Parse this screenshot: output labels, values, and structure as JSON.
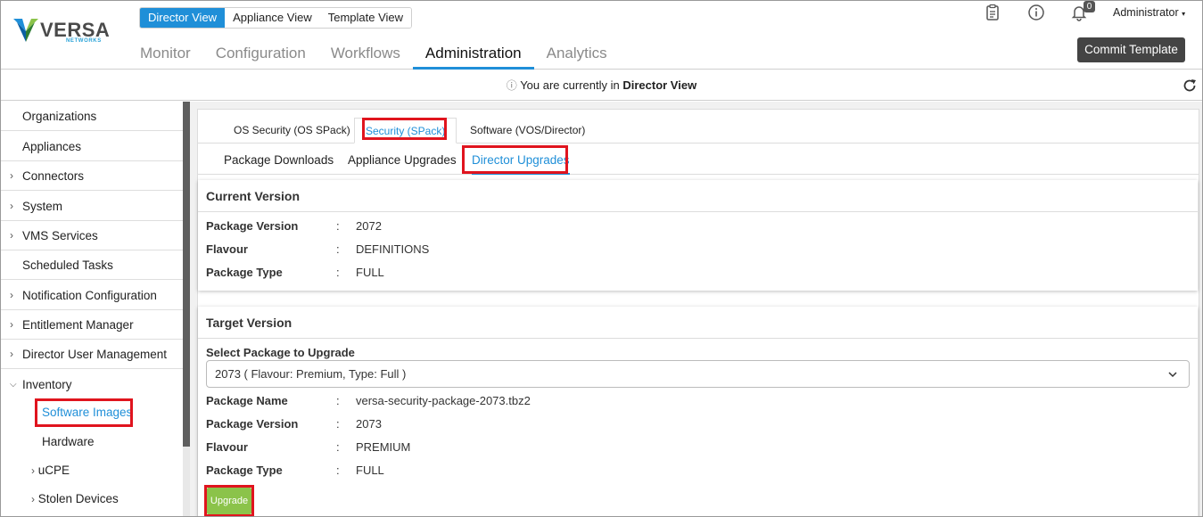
{
  "brand": {
    "name": "VERSA",
    "sub": "NETWORKS"
  },
  "view_switch": {
    "items": [
      "Director View",
      "Appliance View",
      "Template View"
    ],
    "active": "Director View"
  },
  "main_nav": {
    "items": [
      "Monitor",
      "Configuration",
      "Workflows",
      "Administration",
      "Analytics"
    ],
    "active": "Administration"
  },
  "header": {
    "notifications_count": "0",
    "user_menu": "Administrator",
    "commit_label": "Commit Template",
    "icons": [
      "clipboard-icon",
      "info-icon",
      "bell-icon"
    ]
  },
  "banner": {
    "prefix": "You are currently in",
    "view": "Director View"
  },
  "sidebar": {
    "items": [
      {
        "label": "Organizations",
        "chevron": ""
      },
      {
        "label": "Appliances",
        "chevron": ""
      },
      {
        "label": "Connectors",
        "chevron": ">"
      },
      {
        "label": "System",
        "chevron": ">"
      },
      {
        "label": "VMS Services",
        "chevron": ">"
      },
      {
        "label": "Scheduled Tasks",
        "chevron": ""
      },
      {
        "label": "Notification Configuration",
        "chevron": ">"
      },
      {
        "label": "Entitlement Manager",
        "chevron": ">"
      },
      {
        "label": "Director User Management",
        "chevron": ">"
      },
      {
        "label": "Inventory",
        "chevron": "v"
      }
    ],
    "sub_items": [
      {
        "label": "Software Images",
        "chevron": ""
      },
      {
        "label": "Hardware",
        "chevron": ""
      },
      {
        "label": "uCPE",
        "chevron": ">"
      },
      {
        "label": "Stolen Devices",
        "chevron": ">"
      }
    ],
    "active_sub": "Software Images"
  },
  "tabs_top": {
    "items": [
      "OS Security (OS SPack)",
      "Security (SPack)",
      "Software (VOS/Director)"
    ],
    "active": "Security (SPack)"
  },
  "tabs_sub": {
    "items": [
      "Package Downloads",
      "Appliance Upgrades",
      "Director Upgrades"
    ],
    "active": "Director Upgrades"
  },
  "current_version": {
    "title": "Current Version",
    "rows": [
      {
        "key": "Package Version",
        "sep": ":",
        "value": "2072"
      },
      {
        "key": "Flavour",
        "sep": ":",
        "value": "DEFINITIONS"
      },
      {
        "key": "Package Type",
        "sep": ":",
        "value": "FULL"
      }
    ]
  },
  "target_version": {
    "title": "Target Version",
    "select_label": "Select Package to Upgrade",
    "select_value": "2073 ( Flavour: Premium, Type: Full )",
    "rows": [
      {
        "key": "Package Name",
        "sep": ":",
        "value": "versa-security-package-2073.tbz2"
      },
      {
        "key": "Package Version",
        "sep": ":",
        "value": "2073"
      },
      {
        "key": "Flavour",
        "sep": ":",
        "value": "PREMIUM"
      },
      {
        "key": "Package Type",
        "sep": ":",
        "value": "FULL"
      }
    ],
    "upgrade_label": "Upgrade"
  },
  "colors": {
    "accent": "#1f8fd8",
    "highlight": "#e0141e",
    "upgrade": "#8bc34a",
    "commit": "#444444"
  }
}
